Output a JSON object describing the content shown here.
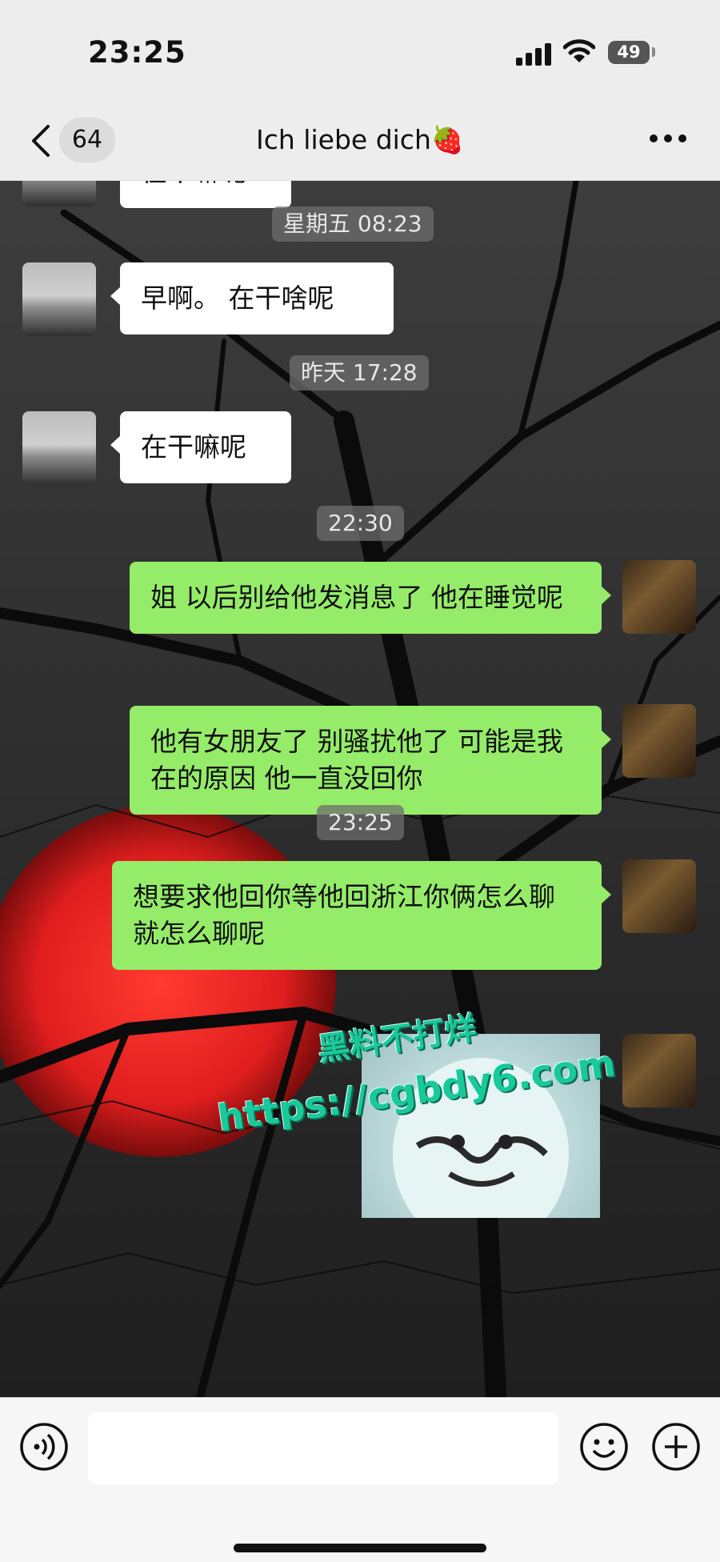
{
  "status_bar": {
    "time": "23:25",
    "battery": "49"
  },
  "nav": {
    "unread_count": "64",
    "title": "Ich liebe dich🍓"
  },
  "messages": [
    {
      "type": "partial_in",
      "text": "在干嘛呢"
    },
    {
      "type": "time",
      "text": "星期五 08:23"
    },
    {
      "type": "in",
      "text": "早啊。 在干啥呢"
    },
    {
      "type": "time",
      "text": "昨天 17:28"
    },
    {
      "type": "in",
      "text": "在干嘛呢"
    },
    {
      "type": "time",
      "text": "22:30"
    },
    {
      "type": "out",
      "text": "姐 以后别给他发消息了 他在睡觉呢"
    },
    {
      "type": "out",
      "text": "他有女朋友了 别骚扰他了 可能是我在的原因 他一直没回你"
    },
    {
      "type": "time",
      "text": "23:25"
    },
    {
      "type": "out",
      "text": "想要求他回你等他回浙江你俩怎么聊就怎么聊呢"
    },
    {
      "type": "out_image"
    }
  ],
  "watermark": {
    "line1": "黑料不打烊",
    "line2": "https://cgbdy6.com"
  },
  "colors": {
    "outgoing_bubble": "#95ec69",
    "incoming_bubble": "#ffffff",
    "chrome": "#ededed"
  },
  "icons": [
    "back-icon",
    "more-icon",
    "voice-icon",
    "emoji-icon",
    "plus-icon"
  ]
}
